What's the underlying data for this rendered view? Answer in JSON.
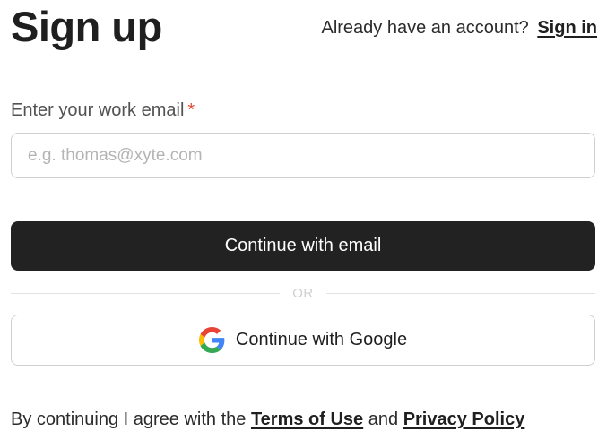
{
  "header": {
    "title": "Sign up",
    "already_text": "Already have an account?",
    "signin_label": "Sign in"
  },
  "email_form": {
    "label": "Enter your work email",
    "required_mark": "*",
    "placeholder": "e.g. thomas@xyte.com",
    "value": "",
    "submit_label": "Continue with email"
  },
  "divider": {
    "label": "OR"
  },
  "google": {
    "label": "Continue with Google",
    "icon": "google-logo-icon",
    "colors": {
      "blue": "#4285F4",
      "red": "#EA4335",
      "yellow": "#FBBC05",
      "green": "#34A853"
    }
  },
  "terms": {
    "prefix": "By continuing I agree with the",
    "terms_label": "Terms of Use",
    "conjunction": "and",
    "privacy_label": "Privacy Policy"
  },
  "colors": {
    "primary_button": "#222222",
    "required": "#e14a3a",
    "border": "#cfcfcf"
  }
}
